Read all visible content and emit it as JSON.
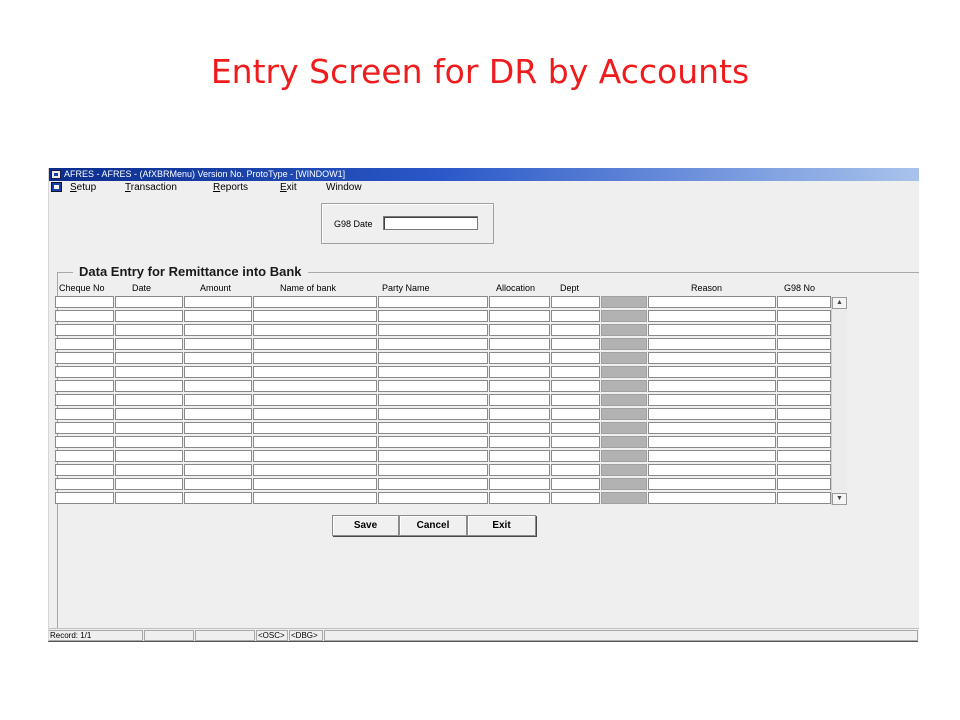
{
  "slide": {
    "title": "Entry Screen for DR by Accounts"
  },
  "window": {
    "title": "AFRES - AFRES - (AfXBRMenu) Version No. ProtoType - [WINDOW1]",
    "app_icon": "app-window-icon",
    "mdi_icon": "mdi-document-icon"
  },
  "menu": {
    "items": [
      {
        "label": "Setup"
      },
      {
        "label": "Transaction"
      },
      {
        "label": "Reports"
      },
      {
        "label": "Exit"
      },
      {
        "label": "Window"
      }
    ]
  },
  "g98": {
    "label": "G98 Date",
    "value": ""
  },
  "frame": {
    "legend": "Data Entry for Remittance into Bank"
  },
  "grid": {
    "columns": [
      {
        "label": "Cheque No"
      },
      {
        "label": "Date"
      },
      {
        "label": "Amount"
      },
      {
        "label": "Name  of bank"
      },
      {
        "label": "Party Name"
      },
      {
        "label": "Allocation"
      },
      {
        "label": "Dept"
      },
      {
        "label": ""
      },
      {
        "label": "Reason"
      },
      {
        "label": "G98 No"
      }
    ],
    "row_count": 15
  },
  "scrollbar": {
    "up_icon": "scroll-up-arrow-icon",
    "down_icon": "scroll-down-arrow-icon"
  },
  "buttons": {
    "save": "Save",
    "cancel": "Cancel",
    "exit": "Exit"
  },
  "status": {
    "record": "Record: 1/1",
    "osc": "<OSC>",
    "dbg": "<DBG>"
  }
}
